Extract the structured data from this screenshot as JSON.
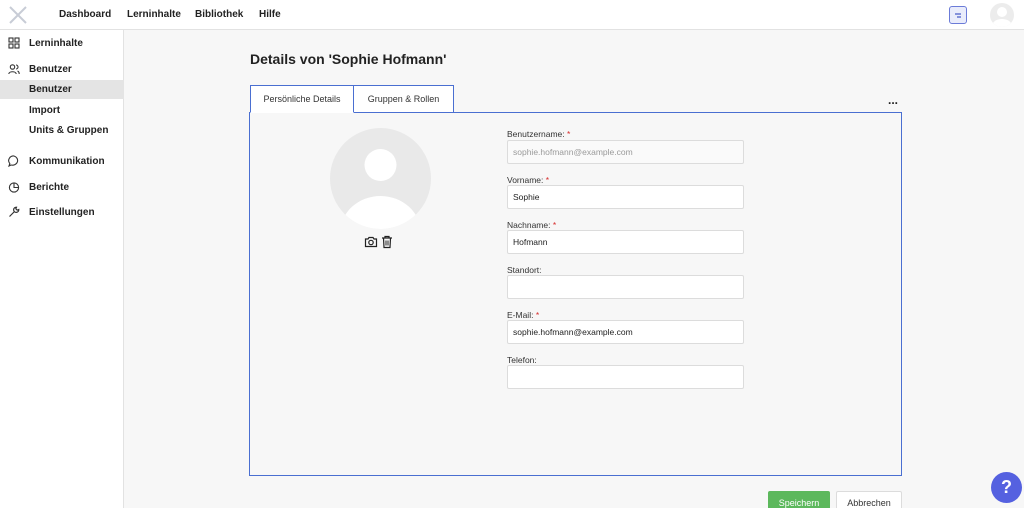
{
  "topnav": {
    "items": [
      "Dashboard",
      "Lerninhalte",
      "Bibliothek",
      "Hilfe"
    ]
  },
  "sidebar": {
    "lerninhalte": "Lerninhalte",
    "benutzer": "Benutzer",
    "sub_benutzer": "Benutzer",
    "sub_import": "Import",
    "sub_units": "Units & Gruppen",
    "kommunikation": "Kommunikation",
    "berichte": "Berichte",
    "einstellungen": "Einstellungen"
  },
  "page": {
    "title": "Details von 'Sophie Hofmann'"
  },
  "tabs": [
    "Persönliche Details",
    "Gruppen & Rollen"
  ],
  "form": {
    "username_label": "Benutzername:",
    "username_value": "sophie.hofmann@example.com",
    "firstname_label": "Vorname:",
    "firstname_value": "Sophie",
    "lastname_label": "Nachname:",
    "lastname_value": "Hofmann",
    "location_label": "Standort:",
    "location_value": "",
    "email_label": "E-Mail:",
    "email_value": "sophie.hofmann@example.com",
    "phone_label": "Telefon:",
    "phone_value": "",
    "required_marker": "*"
  },
  "actions": {
    "save": "Speichern",
    "cancel": "Abbrechen",
    "more": "...",
    "help": "?"
  },
  "colors": {
    "accent": "#4a6fd1",
    "save": "#5cb85c",
    "help": "#5561e0",
    "required": "#d62b2b"
  }
}
